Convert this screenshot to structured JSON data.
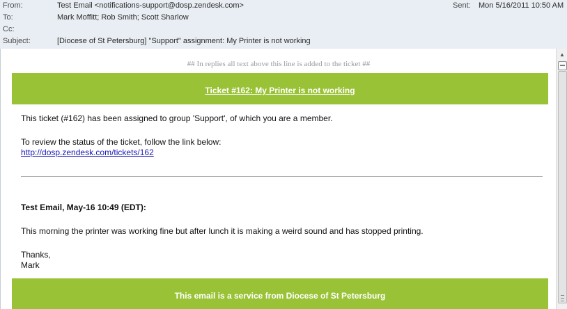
{
  "header": {
    "from_label": "From:",
    "from_value": "Test Email <notifications-support@dosp.zendesk.com>",
    "to_label": "To:",
    "to_value": "Mark Moffitt; Rob Smith; Scott Sharlow",
    "cc_label": "Cc:",
    "cc_value": "",
    "subject_label": "Subject:",
    "subject_value": "[Diocese of St Petersburg] \"Support\" assignment:  My Printer is not working",
    "sent_label": "Sent:",
    "sent_value": "Mon 5/16/2011 10:50 AM"
  },
  "body": {
    "reply_marker": "## In replies all text above this line is added to the ticket ##",
    "ticket_title": "Ticket #162: My Printer is not working",
    "assigned_text": "This ticket (#162) has been assigned to group 'Support', of which you are a member.",
    "review_text": "To review the status of the ticket, follow the link below:",
    "ticket_link": "http://dosp.zendesk.com/tickets/162",
    "comment_header": "Test Email, May-16 10:49 (EDT):",
    "comment_text": "This morning the printer was working fine but after lunch it is making a weird sound and has stopped printing.",
    "thanks": "Thanks,",
    "signature": "Mark",
    "footer_text": "This email is a service from Diocese of St Petersburg"
  },
  "colors": {
    "accent_green": "#99c236",
    "link_blue": "#1a1ab8",
    "header_bg": "#e9eef4"
  },
  "icons": {
    "scroll_up": "arrow-up-icon",
    "pane_icon": "reading-pane-icon"
  }
}
